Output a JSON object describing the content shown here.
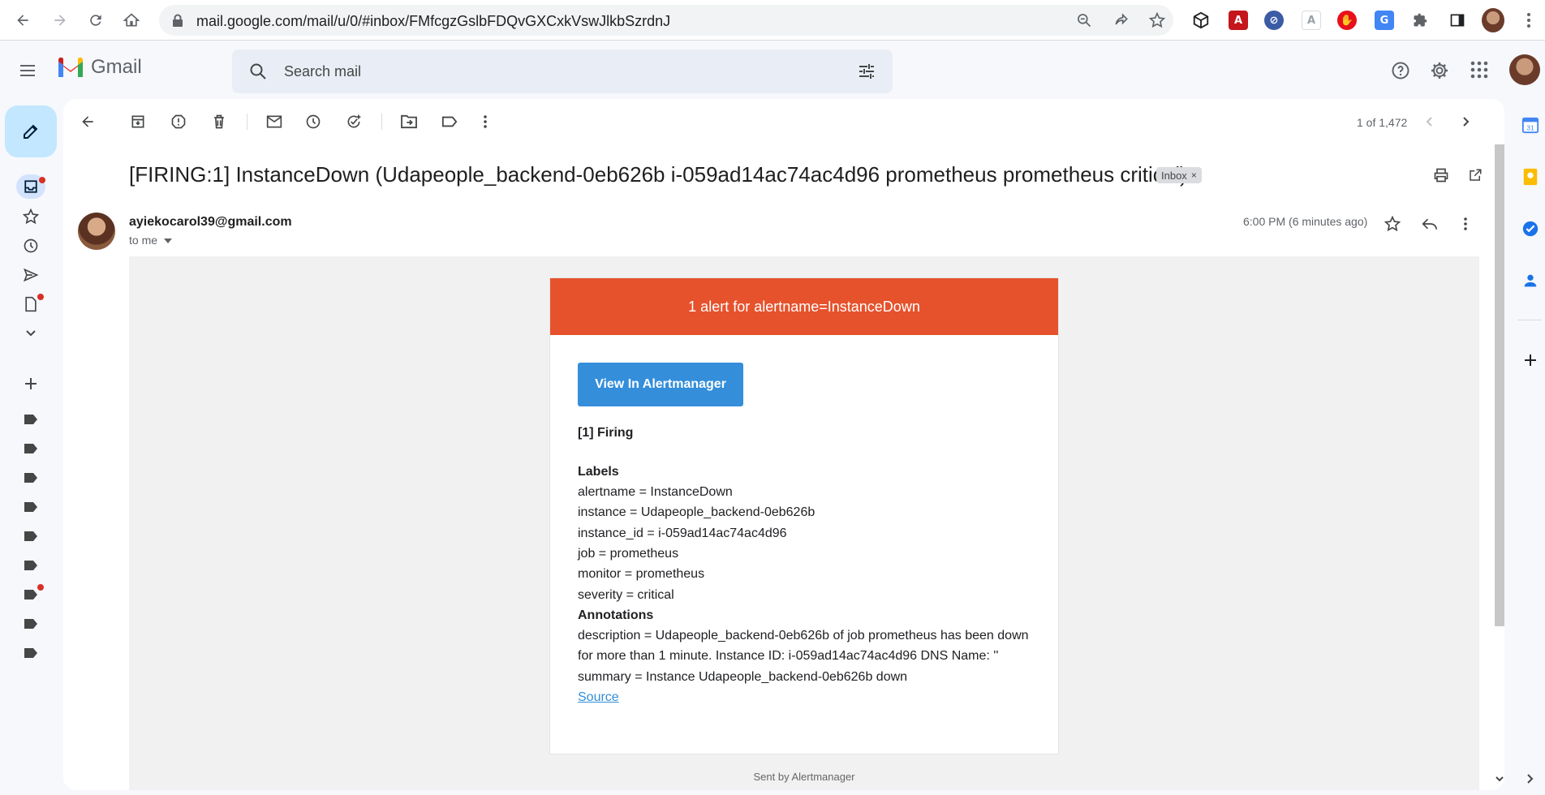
{
  "browser": {
    "url": "mail.google.com/mail/u/0/#inbox/FMfcgzGslbFDQvGXCxkVswJlkbSzrdnJ"
  },
  "gmail": {
    "brand": "Gmail",
    "search_placeholder": "Search mail"
  },
  "toolbar": {
    "pager": "1 of 1,472"
  },
  "message": {
    "subject": "[FIRING:1] InstanceDown (Udapeople_backend-0eb626b i-059ad14ac74ac4d96 prometheus prometheus critical)",
    "label_badge": "Inbox",
    "label_badge_close": "×",
    "sender": "ayiekocarol39@gmail.com",
    "to": "to me",
    "time": "6:00 PM (6 minutes ago)"
  },
  "alert": {
    "header": "1 alert for alertname=InstanceDown",
    "button": "View In Alertmanager",
    "firing": "[1] Firing",
    "labels_title": "Labels",
    "labels": [
      "alertname = InstanceDown",
      "instance = Udapeople_backend-0eb626b",
      "instance_id = i-059ad14ac74ac4d96",
      "job = prometheus",
      "monitor = prometheus",
      "severity = critical"
    ],
    "annotations_title": "Annotations",
    "annotations": [
      "description = Udapeople_backend-0eb626b of job prometheus has been down",
      "for more than 1 minute. Instance ID: i-059ad14ac74ac4d96 DNS Name: ''",
      "summary = Instance Udapeople_backend-0eb626b down"
    ],
    "source_link": "Source",
    "footer": "Sent by Alertmanager"
  },
  "colors": {
    "alert_header": "#e6522c",
    "alert_button": "#348eda",
    "compose_bg": "#c2e7ff",
    "unread_dot": "#d93025"
  },
  "icons": [
    "back-icon",
    "forward-icon",
    "reload-icon",
    "home-icon",
    "lock-icon",
    "zoom-icon",
    "share-icon",
    "star-icon",
    "extensions-icon",
    "menu-icon",
    "search-icon",
    "tune-icon",
    "help-icon",
    "settings-icon",
    "apps-icon",
    "archive-icon",
    "report-spam-icon",
    "delete-icon",
    "mark-unread-icon",
    "snooze-icon",
    "add-task-icon",
    "move-to-icon",
    "label-icon",
    "more-icon",
    "print-icon",
    "open-new-window-icon",
    "reply-icon",
    "pencil-icon",
    "inbox-icon",
    "clock-icon",
    "send-icon",
    "draft-icon",
    "chevron-down-icon",
    "plus-icon",
    "calendar-icon",
    "keep-icon",
    "tasks-icon",
    "contacts-icon"
  ]
}
